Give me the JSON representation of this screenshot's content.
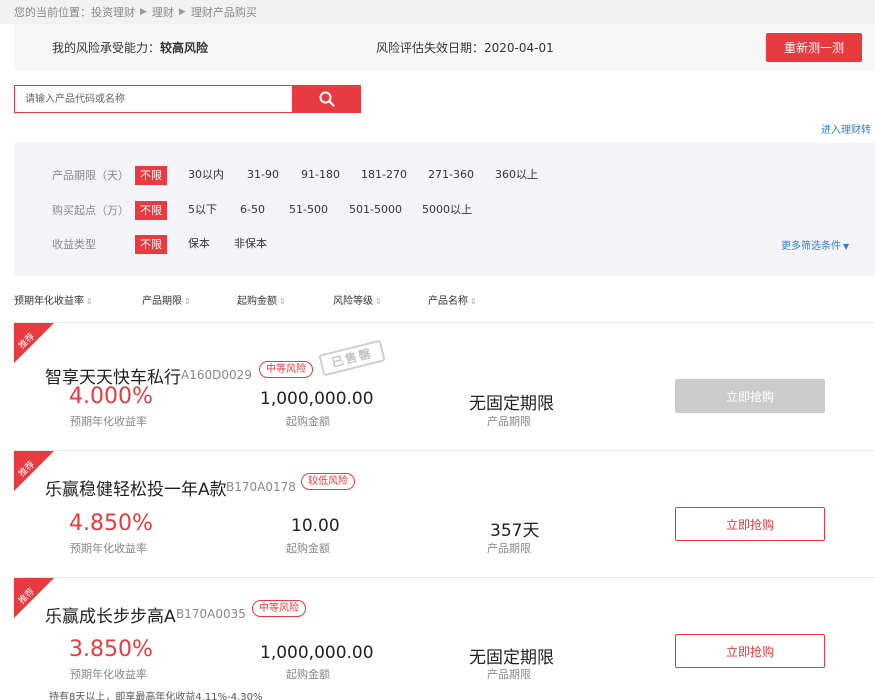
{
  "breadcrumb": {
    "prefix": "您的当前位置：",
    "items": [
      "投资理财",
      "理财",
      "理财产品购买"
    ]
  },
  "risk": {
    "capacity_label": "我的风险承受能力：",
    "capacity_value": "较高风险",
    "expiry_label": "风险评估失效日期：",
    "expiry_value": "2020-04-01",
    "retest_button": "重新测一测"
  },
  "search": {
    "placeholder": "请输入产品代码或名称",
    "value": ""
  },
  "enter_link": "进入理财转",
  "filters": {
    "term": {
      "label": "产品期限（天）",
      "options": [
        "不限",
        "30以内",
        "31-90",
        "91-180",
        "181-270",
        "271-360",
        "360以上"
      ]
    },
    "min_amount": {
      "label": "购买起点（万）",
      "options": [
        "不限",
        "5以下",
        "6-50",
        "51-500",
        "501-5000",
        "5000以上"
      ]
    },
    "yield_type": {
      "label": "收益类型",
      "options": [
        "不限",
        "保本",
        "非保本"
      ]
    },
    "more": "更多筛选条件"
  },
  "sort": [
    "预期年化收益率",
    "产品期限",
    "起购金额",
    "风险等级",
    "产品名称"
  ],
  "products": [
    {
      "ribbon": "推荐",
      "name": "智享天天快车私行",
      "code": "A160D0029",
      "risk": "中等风险",
      "sold_out": "已售罄",
      "rate": "4.000%",
      "rate_label": "预期年化收益率",
      "amount": "1,000,000.00",
      "amount_label": "起购金额",
      "term": "无固定期限",
      "term_label": "产品期限",
      "button": "立即抢购",
      "note": ""
    },
    {
      "ribbon": "推荐",
      "name": "乐赢稳健轻松投一年A款",
      "code": "B170A0178",
      "risk": "较低风险",
      "sold_out": "",
      "rate": "4.850%",
      "rate_label": "预期年化收益率",
      "amount": "10.00",
      "amount_label": "起购金额",
      "term": "357天",
      "term_label": "产品期限",
      "button": "立即抢购",
      "note": ""
    },
    {
      "ribbon": "推荐",
      "name": "乐赢成长步步高A",
      "code": "B170A0035",
      "risk": "中等风险",
      "sold_out": "",
      "rate": "3.850%",
      "rate_label": "预期年化收益率",
      "amount": "1,000,000.00",
      "amount_label": "起购金额",
      "term": "无固定期限",
      "term_label": "产品期限",
      "button": "立即抢购",
      "note": "持有8天以上，即享最高年化收益4.11%-4.30%"
    }
  ],
  "colors": {
    "accent": "#e93a3f",
    "link": "#2f7fd6",
    "disabled": "#cccccc"
  }
}
